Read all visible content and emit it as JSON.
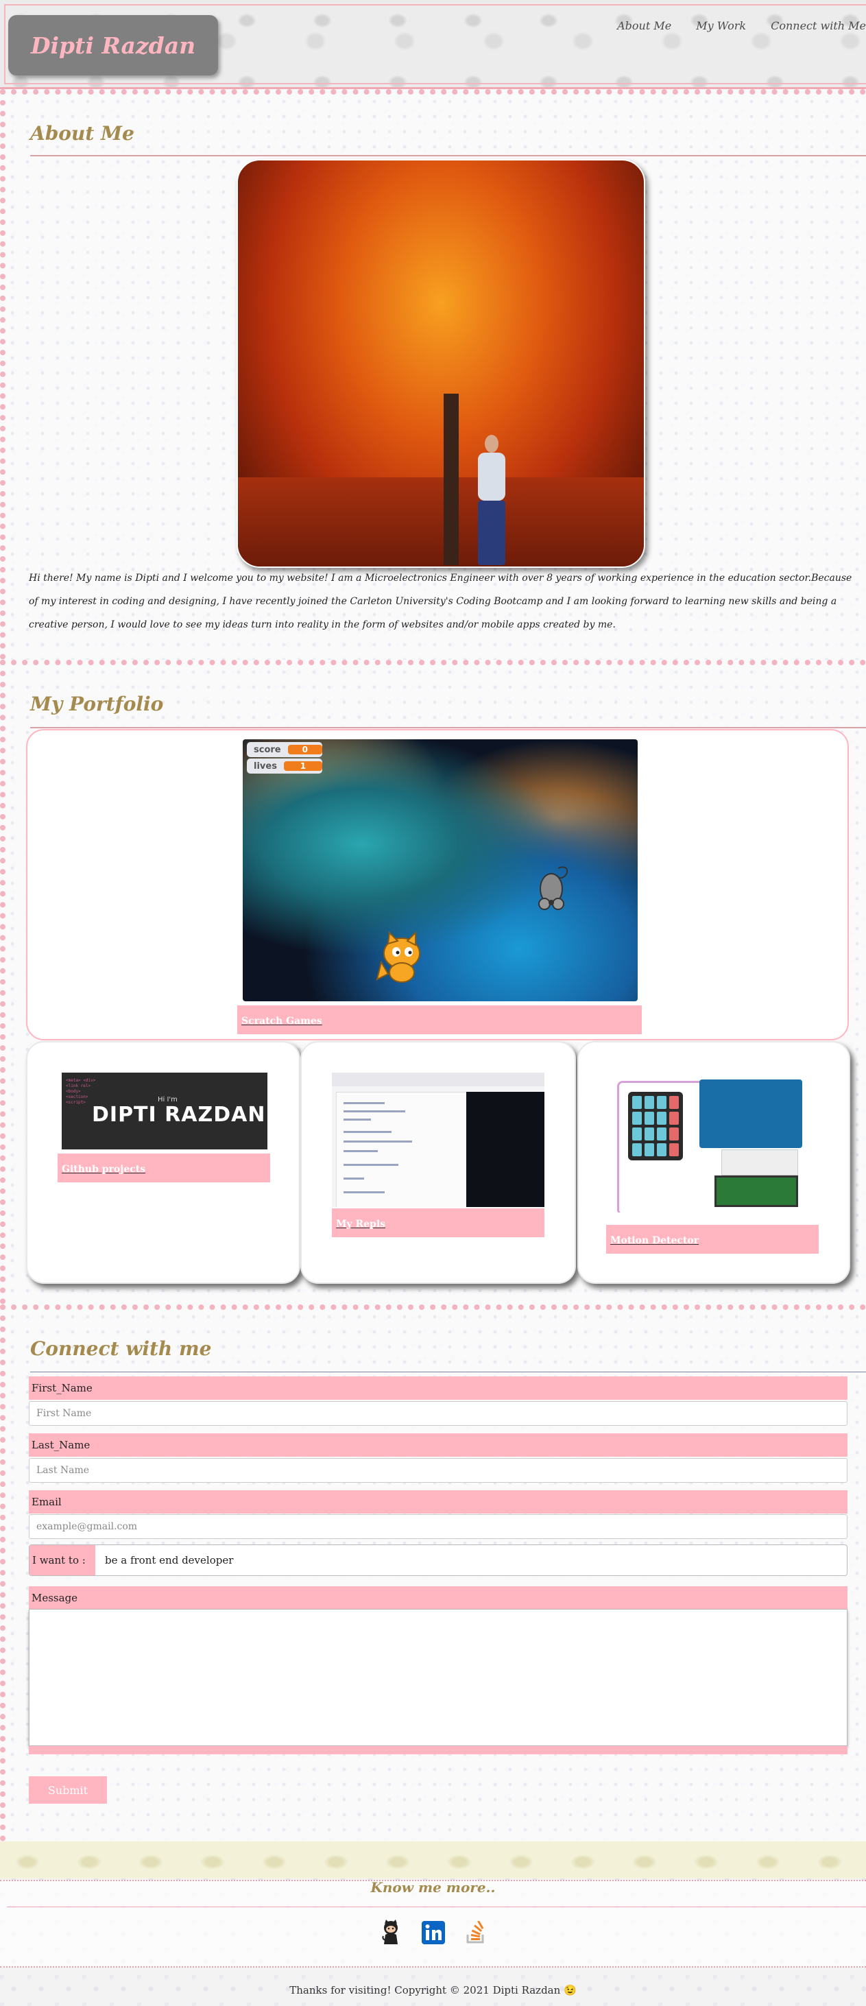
{
  "header": {
    "brand": "Dipti Razdan",
    "nav": [
      "About Me",
      "My Work",
      "Connect with Me"
    ]
  },
  "about": {
    "title": "About Me",
    "text": "Hi there! My name is Dipti and I welcome you to my website! I am a Microelectronics Engineer with over 8 years of working experience in the education sector.Because of my interest in coding and designing, I have recently joined the Carleton University's Coding Bootcamp and I am looking forward to learning new skills and being a creative person, I would love to see my ideas turn into reality in the form of websites and/or mobile apps created by me."
  },
  "portfolio": {
    "title": "My Portfolio",
    "featured": {
      "caption": "Scratch Games",
      "hud": {
        "score_label": "score",
        "score_value": "0",
        "lives_label": "lives",
        "lives_value": "1"
      }
    },
    "projects": [
      {
        "caption": "Github projects",
        "thumb_hi": "Hi I'm",
        "thumb_name": "DIPTI RAZDAN"
      },
      {
        "caption": "My Repls"
      },
      {
        "caption": "Motion Detector"
      }
    ]
  },
  "connect": {
    "title": "Connect with me",
    "first_name_label": "First_Name",
    "first_name_placeholder": "First Name",
    "last_name_label": "Last_Name",
    "last_name_placeholder": "Last Name",
    "email_label": "Email",
    "email_placeholder": "example@gmail.com",
    "want_label": "I want to :",
    "want_value": "be a front end developer",
    "message_label": "Message",
    "submit_label": "Submit"
  },
  "footer": {
    "know_more": "Know me more..",
    "socials": [
      "github-icon",
      "linkedin-icon",
      "stackoverflow-icon"
    ],
    "copyright": "Thanks for visiting! Copyright © 2021 Dipti Razdan 😉"
  },
  "colors": {
    "accent_pink": "#ffb6c1",
    "title_gold": "#a58a4d",
    "brand_bg": "#808080"
  }
}
